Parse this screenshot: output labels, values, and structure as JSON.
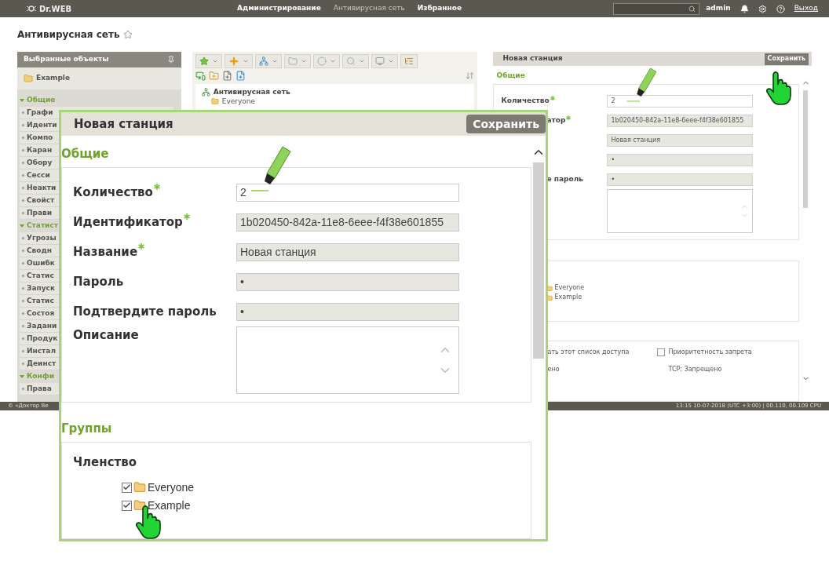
{
  "header": {
    "logo": "Dr.WEB",
    "nav": [
      {
        "label": "Администрирование",
        "selected": false
      },
      {
        "label": "Антивирусная сеть",
        "selected": true
      },
      {
        "label": "Избранное",
        "selected": false
      }
    ],
    "user": "admin",
    "logout": "Выход"
  },
  "page_title": "Антивирусная сеть",
  "sidebar": {
    "title": "Выбранные объекты",
    "favorite": "Example",
    "groups": [
      {
        "title": "Общие",
        "expanded": true,
        "items": [
          "Графи",
          "Иденти",
          "Компо",
          "Каран",
          "Обору",
          "Сесси",
          "Неакти",
          "Свойст",
          "Прави"
        ]
      },
      {
        "title": "Статист",
        "expanded": true,
        "items": [
          "Угрозы",
          "Сводн",
          "Ошибк",
          "Статис",
          "Запуск",
          "Статис",
          "Состоя",
          "Задани",
          "Продук",
          "Инстал",
          "Деинст"
        ]
      },
      {
        "title": "Конфи",
        "expanded": true,
        "items": [
          "Права"
        ]
      }
    ]
  },
  "tree": {
    "root": "Антивирусная сеть",
    "children": [
      {
        "label": "Everyone"
      }
    ]
  },
  "right_panel": {
    "title": "Новая станция",
    "save": "Сохранить",
    "section": "Общие",
    "fields": [
      {
        "kind": "input",
        "label": "Количество",
        "partial": false,
        "required": true,
        "value": "2",
        "editable": true
      },
      {
        "kind": "input",
        "label": "атор",
        "partial": true,
        "required": true,
        "value": "1b020450-842a-11e8-6eee-f4f38e601855",
        "editable": false
      },
      {
        "kind": "input",
        "value": "Новая станция",
        "editable": false
      },
      {
        "kind": "input",
        "value": "•",
        "editable": false
      },
      {
        "kind": "input",
        "label": "е пароль",
        "partial": true,
        "required": false,
        "value": "•",
        "editable": false
      },
      {
        "kind": "textarea"
      }
    ],
    "groups": [
      {
        "label": "Everyone"
      },
      {
        "label": "Example"
      }
    ],
    "access": [
      {
        "kind": "text",
        "text": "ать этот список доступа"
      },
      {
        "kind": "checkbox",
        "text": "Приоритетность запрета",
        "checked": false
      }
    ],
    "rules": [
      "ено",
      "TCP: Запрещено"
    ]
  },
  "overlay": {
    "title": "Новая станция",
    "save": "Сохранить",
    "section": "Общие",
    "fields": [
      {
        "kind": "input",
        "label": "Количество",
        "required": true,
        "value": "2",
        "editable": true
      },
      {
        "kind": "input",
        "label": "Идентификатор",
        "required": true,
        "value": "1b020450-842a-11e8-6eee-f4f38e601855",
        "editable": false
      },
      {
        "kind": "input",
        "label": "Название",
        "required": true,
        "value": "Новая станция",
        "editable": false
      },
      {
        "kind": "input",
        "label": "Пароль",
        "required": false,
        "value": "•",
        "editable": false
      },
      {
        "kind": "input",
        "label": "Подтвердите пароль",
        "required": false,
        "value": "•",
        "editable": false
      },
      {
        "kind": "textarea",
        "label": "Описание",
        "required": false
      }
    ],
    "groups_section": "Группы",
    "membership": "Членство",
    "groups": [
      {
        "label": "Everyone",
        "checked": true
      },
      {
        "label": "Example",
        "checked": true
      }
    ]
  },
  "status_bar": {
    "left": "© «Доктор Ве",
    "right": "13:15 10-07-2018 (UTC +3:00) | 00.110, 00.109 CPU"
  }
}
